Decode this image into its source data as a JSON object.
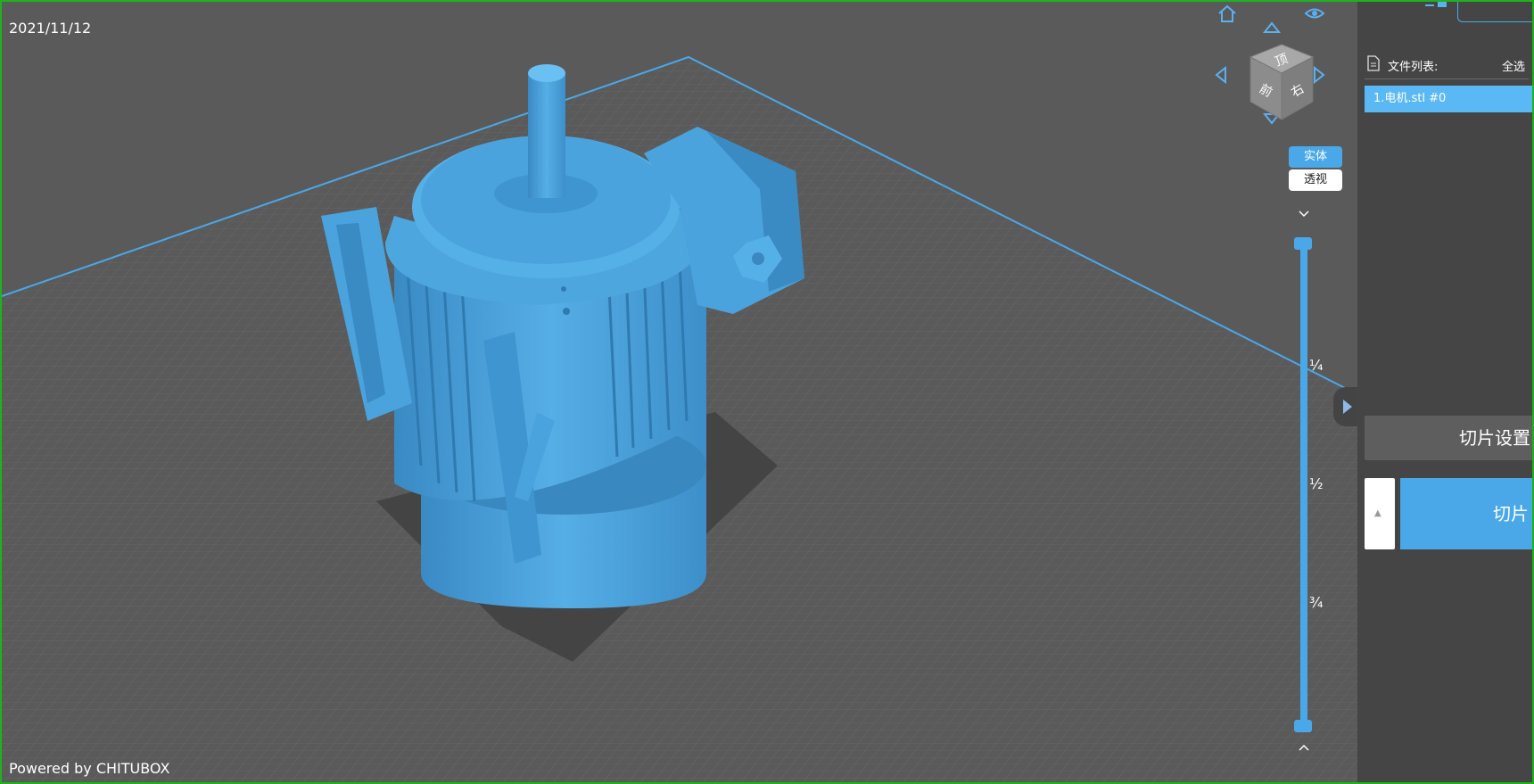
{
  "viewport": {
    "date": "2021/11/12",
    "powered_by": "Powered by CHITUBOX",
    "cube": {
      "top": "顶",
      "front": "前",
      "right": "右"
    },
    "view_modes": [
      {
        "label": "实体",
        "active": true
      },
      {
        "label": "透视",
        "active": false
      }
    ],
    "slider": {
      "marks": [
        "¼",
        "½",
        "¾"
      ],
      "range_low": 0,
      "range_high": 1
    },
    "colors": {
      "accent": "#4aa8e8",
      "model": "#4a9fd8",
      "grid": "#5a5a5a"
    },
    "icons": [
      "home-icon",
      "eye-icon",
      "arrow-up-icon",
      "arrow-down-icon",
      "arrow-left-icon",
      "arrow-right-icon",
      "chevron-down-icon",
      "chevron-up-icon"
    ]
  },
  "sidebar": {
    "file_list_label": "文件列表:",
    "select_all": "全选",
    "files": [
      {
        "name": "1.电机.stl #0",
        "selected": true
      }
    ],
    "slice_settings": "切片设置",
    "slice": "切片"
  }
}
